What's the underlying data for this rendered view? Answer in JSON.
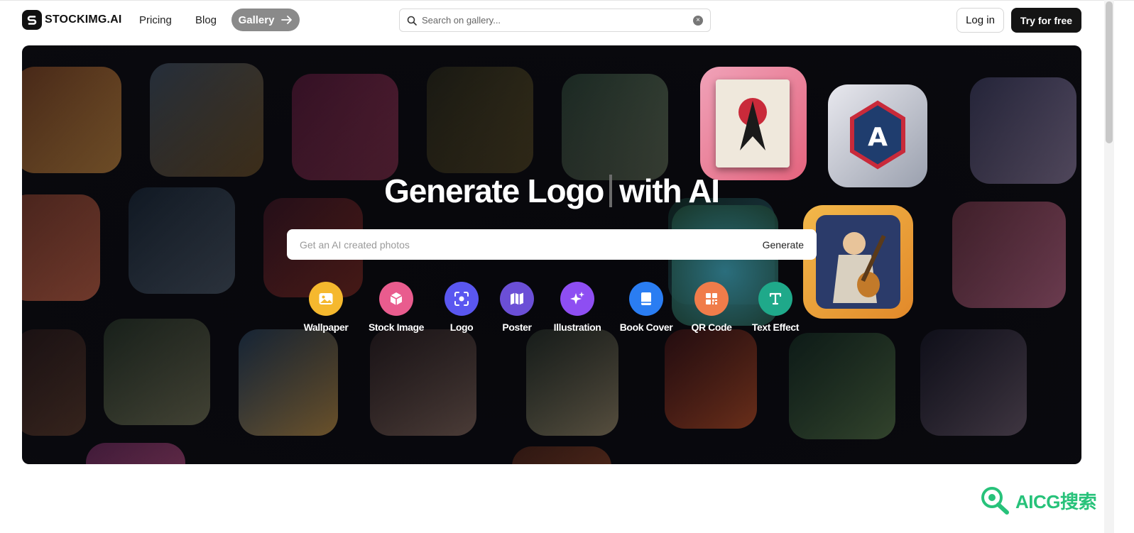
{
  "nav": {
    "brand": "STOCKIMG.AI",
    "links": [
      {
        "label": "Pricing"
      },
      {
        "label": "Blog"
      }
    ],
    "gallery_label": "Gallery",
    "search_placeholder": "Search on gallery...",
    "login_label": "Log in",
    "try_label": "Try for free"
  },
  "hero": {
    "headline_part1": "Generate Logo",
    "headline_part2": "with AI",
    "prompt_placeholder": "Get an AI created photos",
    "generate_label": "Generate",
    "categories": [
      {
        "label": "Wallpaper",
        "icon": "image-icon",
        "color": "#f5b82e"
      },
      {
        "label": "Stock Image",
        "icon": "box-icon",
        "color": "#e95c8e"
      },
      {
        "label": "Logo",
        "icon": "focus-icon",
        "color": "#5a57f0"
      },
      {
        "label": "Poster",
        "icon": "map-icon",
        "color": "#6b4fd6"
      },
      {
        "label": "Illustration",
        "icon": "sparkles-icon",
        "color": "#8e4ef2"
      },
      {
        "label": "Book Cover",
        "icon": "book-icon",
        "color": "#2a7df2"
      },
      {
        "label": "QR Code",
        "icon": "qr-icon",
        "color": "#f07c4a"
      },
      {
        "label": "Text Effect",
        "icon": "text-icon",
        "color": "#1fa98a"
      }
    ]
  },
  "watermark": {
    "text": "AICG搜索"
  },
  "colors": {
    "hero_bg": "#0c0c10",
    "try_button": "#141414",
    "gallery_button": "#8a8a8a",
    "watermark": "#27c27a"
  }
}
